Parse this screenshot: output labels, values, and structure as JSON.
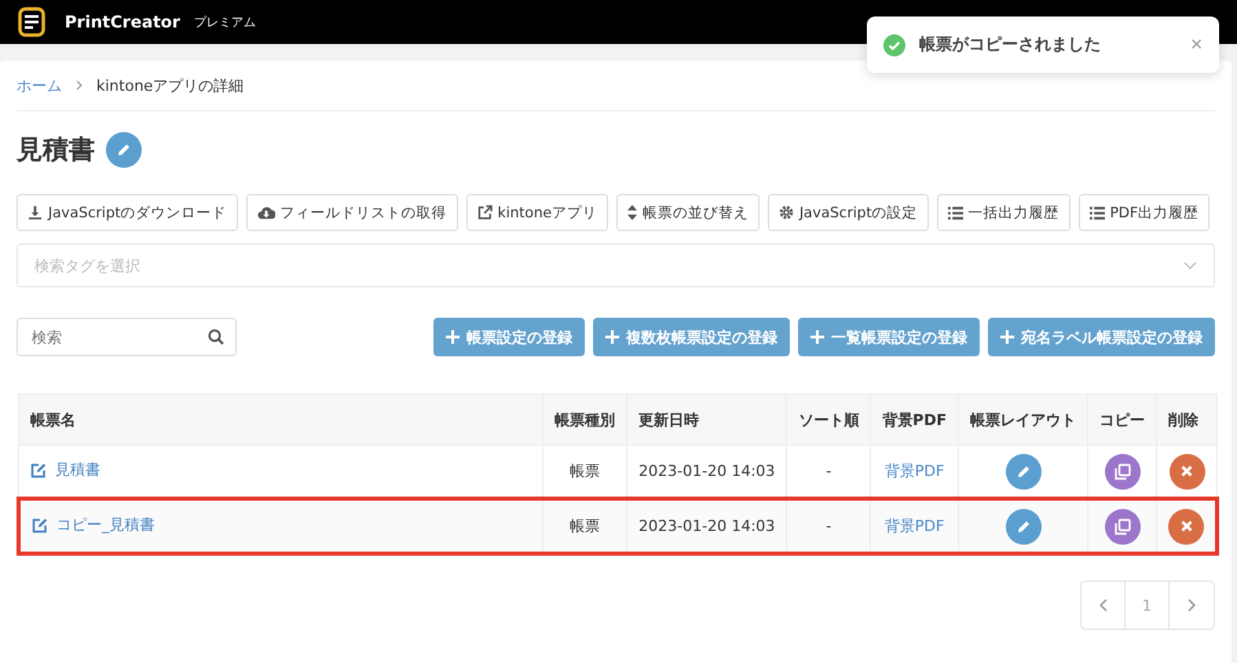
{
  "header": {
    "app_name": "PrintCreator",
    "plan": "プレミアム"
  },
  "toast": {
    "message": "帳票がコピーされました",
    "close": "×"
  },
  "breadcrumb": [
    {
      "label": "ホーム",
      "link": true
    },
    {
      "label": "kintoneアプリの詳細",
      "link": false
    }
  ],
  "page_title": "見積書",
  "toolbar": [
    {
      "label": "JavaScriptのダウンロード",
      "kind": "download"
    },
    {
      "label": "フィールドリストの取得",
      "kind": "cloud"
    },
    {
      "label": "kintoneアプリ",
      "kind": "external"
    },
    {
      "label": "帳票の並び替え",
      "kind": "sort"
    },
    {
      "label": "JavaScriptの設定",
      "kind": "settings"
    },
    {
      "label": "一括出力履歴",
      "kind": "list"
    },
    {
      "label": "PDF出力履歴",
      "kind": "list"
    }
  ],
  "tag_select": {
    "placeholder": "検索タグを選択"
  },
  "search": {
    "placeholder": "検索"
  },
  "create_buttons": [
    "帳票設定の登録",
    "複数枚帳票設定の登録",
    "一覧帳票設定の登録",
    "宛名ラベル帳票設定の登録"
  ],
  "table": {
    "columns": [
      "帳票名",
      "帳票種別",
      "更新日時",
      "ソート順",
      "背景PDF",
      "帳票レイアウト",
      "コピー",
      "削除"
    ],
    "rows": [
      {
        "name": "見積書",
        "type": "帳票",
        "updated": "2023-01-20 14:03",
        "sort": "-",
        "pdf": "背景PDF",
        "highlighted": false
      },
      {
        "name": "コピー_見積書",
        "type": "帳票",
        "updated": "2023-01-20 14:03",
        "sort": "-",
        "pdf": "背景PDF",
        "highlighted": true
      }
    ]
  },
  "pagination": {
    "pages": [
      {
        "label": "1",
        "selected": false
      }
    ]
  }
}
